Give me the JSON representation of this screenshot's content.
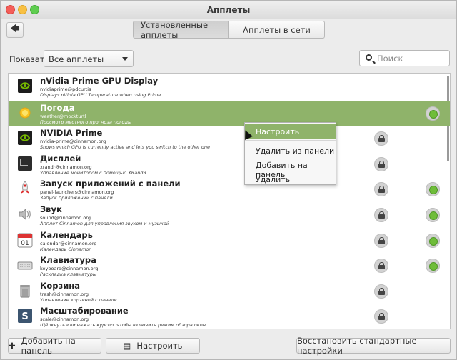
{
  "window": {
    "title": "Апплеты"
  },
  "toolbar": {
    "tabs": [
      {
        "label": "Установленные апплеты"
      },
      {
        "label": "Апплеты в сети"
      }
    ]
  },
  "filter": {
    "show_label": "Показать",
    "selected": "Все апплеты",
    "search_placeholder": "Поиск"
  },
  "applets": [
    {
      "name": "nVidia Prime GPU Display",
      "uuid": "nvidiaprime@pdcurtis",
      "desc": "Displays nVidia GPU Temperature when using Prime",
      "icon": "nvidia-icon",
      "control": "none"
    },
    {
      "name": "Погода",
      "uuid": "weather@mockturtl",
      "desc": "Просмотр местного прогноза погоды",
      "icon": "weather-sun-icon",
      "control": "status",
      "selected": true
    },
    {
      "name": "NVIDIA Prime",
      "uuid": "nvidia-prime@cinnamon.org",
      "desc": "Shows which GPU is currently active and lets you switch to the other one",
      "icon": "nvidia-icon",
      "control": "lock"
    },
    {
      "name": "Дисплей",
      "uuid": "xrandr@cinnamon.org",
      "desc": "Управление монитором с помощью XRandR",
      "icon": "display-icon",
      "control": "lock"
    },
    {
      "name": "Запуск приложений с панели",
      "uuid": "panel-launchers@cinnamon.org",
      "desc": "Запуск приложений с панели",
      "icon": "rocket-icon",
      "control": "lock-status"
    },
    {
      "name": "Звук",
      "uuid": "sound@cinnamon.org",
      "desc": "Апплет Cinnamon для управления звуком и музыкой",
      "icon": "speaker-icon",
      "control": "lock-status"
    },
    {
      "name": "Календарь",
      "uuid": "calendar@cinnamon.org",
      "desc": "Календарь Cinnamon",
      "icon": "calendar-icon",
      "control": "lock-status",
      "calendar_day": "01"
    },
    {
      "name": "Клавиатура",
      "uuid": "keyboard@cinnamon.org",
      "desc": "Раскладка клавиатуры",
      "icon": "keyboard-icon",
      "control": "lock-status"
    },
    {
      "name": "Корзина",
      "uuid": "trash@cinnamon.org",
      "desc": "Управление корзиной с панели",
      "icon": "trash-icon",
      "control": "lock"
    },
    {
      "name": "Масштабирование",
      "uuid": "scale@cinnamon.org",
      "desc": "Щёлкнуть или нажать курсор, чтобы включить режим обзора окон",
      "icon": "scale-icon",
      "control": "lock"
    }
  ],
  "context_menu": {
    "items": [
      {
        "label": "Настроить",
        "highlighted": true
      },
      {
        "label": "Удалить из панели"
      },
      {
        "label": "Добавить на панель"
      },
      {
        "label": "Удалить"
      }
    ]
  },
  "bottom": {
    "add_label": "Добавить на панель",
    "configure_label": "Настроить",
    "restore_label": "Восстановить стандартные настройки"
  },
  "colors": {
    "selection": "#8fb36a",
    "status_green": "#6fbd3a"
  }
}
